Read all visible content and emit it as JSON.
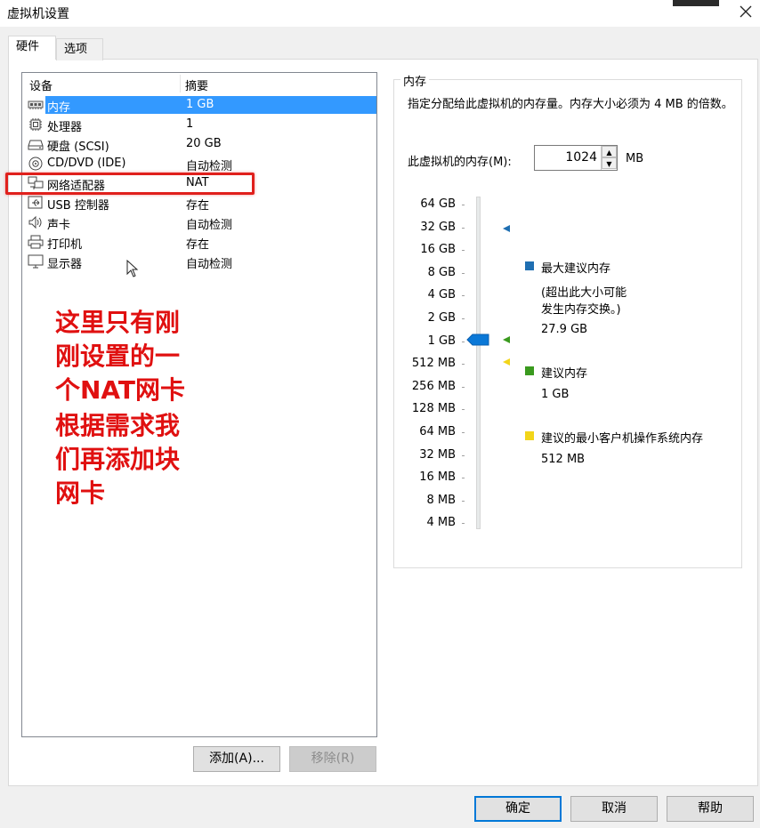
{
  "window": {
    "title": "虚拟机设置"
  },
  "tabs": [
    {
      "label": "硬件"
    },
    {
      "label": "选项"
    }
  ],
  "device_table": {
    "headers": [
      "设备",
      "摘要"
    ],
    "rows": [
      {
        "name": "内存",
        "value": "1 GB",
        "icon": "memory-icon",
        "selected": true
      },
      {
        "name": "处理器",
        "value": "1",
        "icon": "processor-icon"
      },
      {
        "name": "硬盘 (SCSI)",
        "value": "20 GB",
        "icon": "hard-disk-icon"
      },
      {
        "name": "CD/DVD (IDE)",
        "value": "自动检测",
        "icon": "cd-dvd-icon"
      },
      {
        "name": "网络适配器",
        "value": "NAT",
        "icon": "network-adapter-icon"
      },
      {
        "name": "USB 控制器",
        "value": "存在",
        "icon": "usb-icon"
      },
      {
        "name": "声卡",
        "value": "自动检测",
        "icon": "sound-card-icon"
      },
      {
        "name": "打印机",
        "value": "存在",
        "icon": "printer-icon"
      },
      {
        "name": "显示器",
        "value": "自动检测",
        "icon": "display-icon"
      }
    ]
  },
  "annotation": {
    "lines_1": [
      "这里只有刚",
      "刚设置的一",
      "个NAT网卡"
    ],
    "lines_2": [
      "根据需求我",
      "们再添加块",
      "网卡"
    ],
    "color": "#e01010"
  },
  "buttons": {
    "add": "添加(A)...",
    "remove": "移除(R)",
    "ok": "确定",
    "cancel": "取消",
    "help": "帮助"
  },
  "memory": {
    "group_title": "内存",
    "description": "指定分配给此虚拟机的内存量。内存大小必须为 4 MB 的倍数。",
    "label": "此虚拟机的内存(M):",
    "value": "1024",
    "unit": "MB",
    "scale_labels": [
      "64 GB",
      "32 GB",
      "16 GB",
      "8 GB",
      "4 GB",
      "2 GB",
      "1 GB",
      "512 MB",
      "256 MB",
      "128 MB",
      "64 MB",
      "32 MB",
      "16 MB",
      "8 MB",
      "4 MB"
    ],
    "legend": {
      "max_recommended": {
        "title": "最大建议内存",
        "note_1": "(超出此大小可能",
        "note_2": "发生内存交换。)",
        "value": "27.9 GB",
        "color": "#1f6fb2"
      },
      "recommended": {
        "title": "建议内存",
        "value": "1 GB",
        "color": "#3a9a1e"
      },
      "guest_min": {
        "title": "建议的最小客户机操作系统内存",
        "value": "512 MB",
        "color": "#f2d51a"
      }
    },
    "slider_thumb_color": "#0a78d7"
  }
}
